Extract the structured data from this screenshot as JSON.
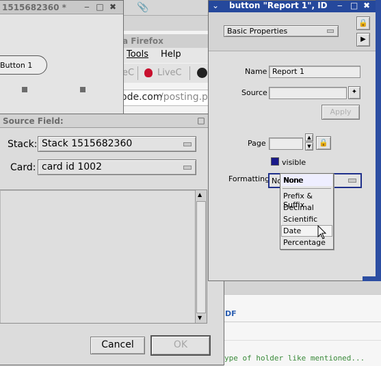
{
  "stack_window": {
    "title": "1515682360 *",
    "button_label": "Button 1"
  },
  "browser": {
    "title": "a Firefox",
    "menu": [
      "Tools",
      "Help"
    ],
    "toolbar_items": [
      "eC",
      "LiveC"
    ],
    "url": {
      "domain": "ode.com",
      "path": "/posting.ph"
    },
    "link_text": "DF",
    "code_line": "ype of holder like mentioned..."
  },
  "source_dialog": {
    "title": "Source Field:",
    "stack_label": "Stack:",
    "stack_value": "Stack 1515682360",
    "card_label": "Card:",
    "card_value": "card id 1002",
    "cancel_label": "Cancel",
    "ok_label": "OK"
  },
  "inspector": {
    "title": "button \"Report 1\", ID",
    "section": "Basic Properties",
    "name_label": "Name",
    "name_value": "Report 1",
    "source_label": "Source",
    "source_value": "",
    "apply_label": "Apply",
    "page_label": "Page",
    "page_value": "",
    "visible_label": "visible",
    "formatting_label": "Formatting",
    "formatting_value": "None",
    "formatting_prefix": "No",
    "formatting_options": [
      "None",
      "Prefix & Suffix",
      "Decimal",
      "Scientific",
      "Date",
      "Percentage"
    ],
    "highlighted_option_index": 4
  }
}
